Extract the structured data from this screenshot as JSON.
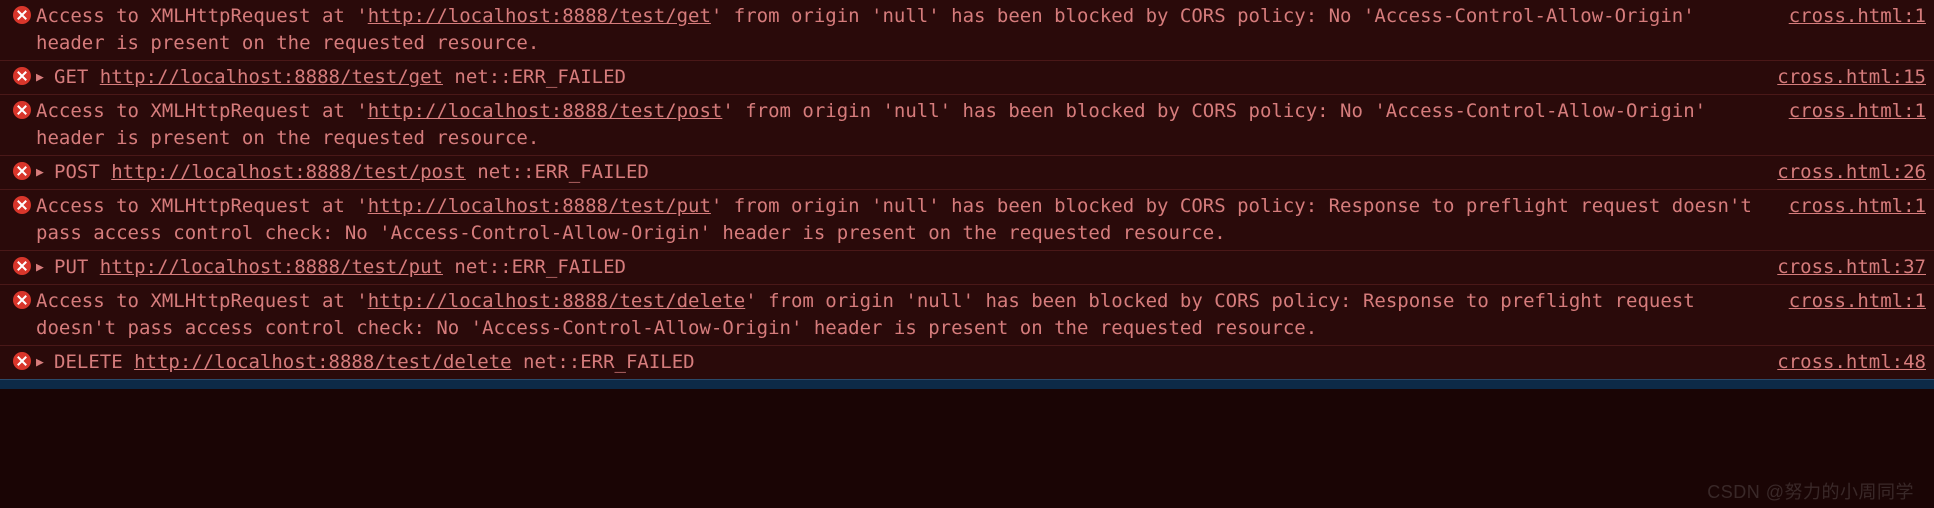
{
  "entries": [
    {
      "kind": "cors",
      "pre": "Access to XMLHttpRequest at '",
      "url": "http://localhost:8888/test/get",
      "post": "' from origin 'null' has been blocked by CORS policy: No 'Access-Control-Allow-Origin' header is present on the requested resource.",
      "source": "cross.html:1"
    },
    {
      "kind": "net",
      "method": "GET",
      "url": "http://localhost:8888/test/get",
      "status": " net::ERR_FAILED",
      "source": "cross.html:15"
    },
    {
      "kind": "cors",
      "pre": "Access to XMLHttpRequest at '",
      "url": "http://localhost:8888/test/post",
      "post": "' from origin 'null' has been blocked by CORS policy: No 'Access-Control-Allow-Origin' header is present on the requested resource.",
      "source": "cross.html:1"
    },
    {
      "kind": "net",
      "method": "POST",
      "url": "http://localhost:8888/test/post",
      "status": " net::ERR_FAILED",
      "source": "cross.html:26"
    },
    {
      "kind": "cors",
      "pre": "Access to XMLHttpRequest at '",
      "url": "http://localhost:8888/test/put",
      "post": "' from origin 'null' has been blocked by CORS policy: Response to preflight request doesn't pass access control check: No 'Access-Control-Allow-Origin' header is present on the requested resource.",
      "source": "cross.html:1"
    },
    {
      "kind": "net",
      "method": "PUT",
      "url": "http://localhost:8888/test/put",
      "status": " net::ERR_FAILED",
      "source": "cross.html:37"
    },
    {
      "kind": "cors",
      "pre": "Access to XMLHttpRequest at '",
      "url": "http://localhost:8888/test/delete",
      "post": "' from origin 'null' has been blocked by CORS policy: Response to preflight request doesn't pass access control check: No 'Access-Control-Allow-Origin' header is present on the requested resource.",
      "source": "cross.html:1"
    },
    {
      "kind": "net",
      "method": "DELETE",
      "url": "http://localhost:8888/test/delete",
      "status": " net::ERR_FAILED",
      "source": "cross.html:48"
    }
  ],
  "disclosure_glyph": "▶",
  "watermark": "CSDN @努力的小周同学"
}
